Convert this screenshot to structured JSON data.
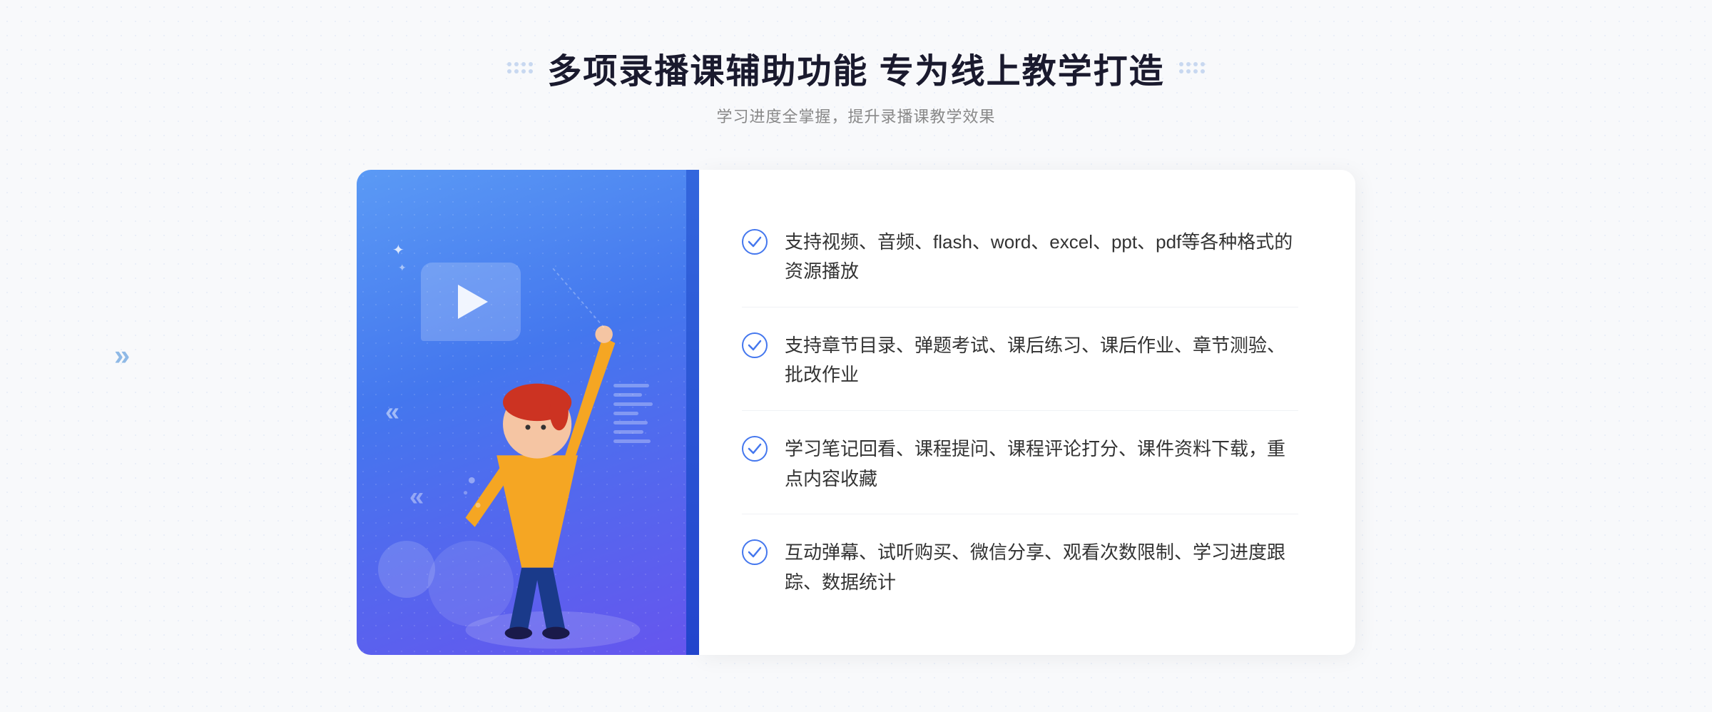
{
  "header": {
    "title": "多项录播课辅助功能 专为线上教学打造",
    "subtitle": "学习进度全掌握，提升录播课教学效果"
  },
  "features": [
    {
      "id": 1,
      "text": "支持视频、音频、flash、word、excel、ppt、pdf等各种格式的资源播放"
    },
    {
      "id": 2,
      "text": "支持章节目录、弹题考试、课后练习、课后作业、章节测验、批改作业"
    },
    {
      "id": 3,
      "text": "学习笔记回看、课程提问、课程评论打分、课件资料下载，重点内容收藏"
    },
    {
      "id": 4,
      "text": "互动弹幕、试听购买、微信分享、观看次数限制、学习进度跟踪、数据统计"
    }
  ],
  "left_arrow": "»",
  "accent_color": "#4477ee"
}
